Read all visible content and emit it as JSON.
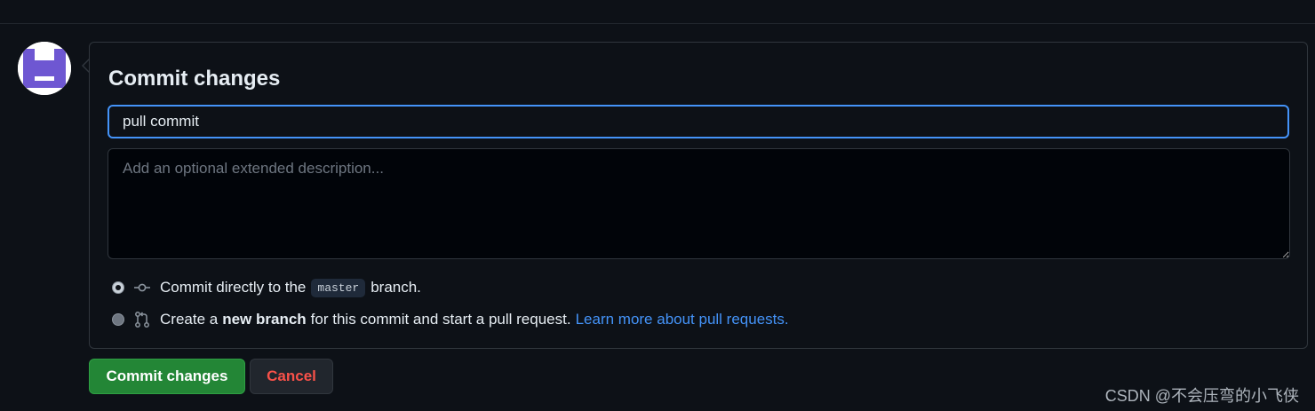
{
  "commit_form": {
    "title": "Commit changes",
    "summary_value": "pull commit",
    "description_placeholder": "Add an optional extended description...",
    "options": {
      "direct": {
        "prefix": "Commit directly to the",
        "branch": "master",
        "suffix": "branch.",
        "selected": true
      },
      "new_branch": {
        "prefix": "Create a",
        "bold": "new branch",
        "middle": "for this commit and start a pull request.",
        "link": "Learn more about pull requests.",
        "selected": false
      }
    }
  },
  "buttons": {
    "commit_label": "Commit changes",
    "cancel_label": "Cancel"
  },
  "watermark": "CSDN @不会压弯的小飞侠",
  "colors": {
    "background": "#0d1117",
    "accent_blue": "#4493f8",
    "commit_green": "#238636",
    "cancel_red": "#f85149",
    "avatar_purple": "#6e57d2"
  },
  "icons": {
    "commit": "git-commit-icon",
    "pull_request": "git-pull-request-icon",
    "avatar": "identicon-avatar"
  }
}
